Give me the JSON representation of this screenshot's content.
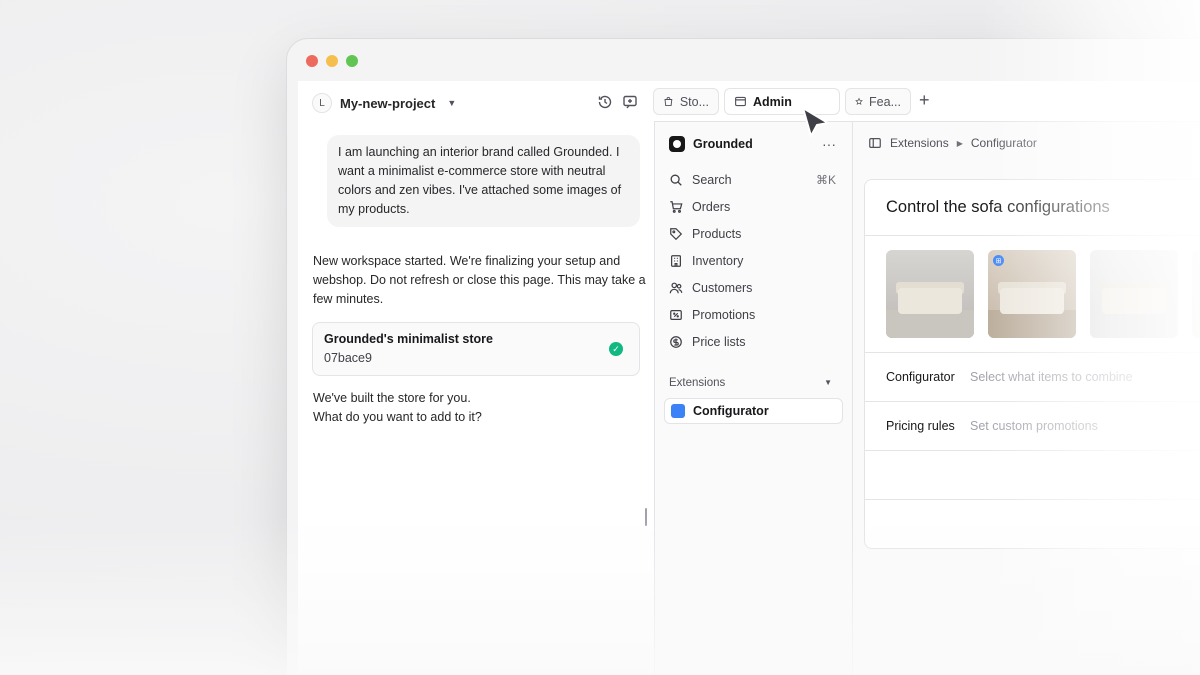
{
  "project": {
    "avatar_initial": "L",
    "name": "My-new-project"
  },
  "chat": {
    "user_message": "I am launching an interior brand called Grounded. I want a minimalist e-commerce store with neutral colors and zen vibes. I've attached some images of my products.",
    "ai_message_1": "New workspace started. We're finalizing your setup and webshop. Do not refresh or close this page. This may take a few minutes.",
    "card": {
      "title": "Grounded's minimalist store",
      "commit": "07bace9"
    },
    "ai_message_2_line1": "We've built the store for you.",
    "ai_message_2_line2": "What do you want to add to it?"
  },
  "tabs": [
    {
      "label": "Sto...",
      "icon": "bag-icon"
    },
    {
      "label": "Admin",
      "icon": "window-icon"
    },
    {
      "label": "Fea...",
      "icon": "star-icon"
    }
  ],
  "sidebar": {
    "store_name": "Grounded",
    "items": [
      {
        "label": "Search",
        "icon": "search-icon",
        "shortcut": "⌘K"
      },
      {
        "label": "Orders",
        "icon": "cart-icon"
      },
      {
        "label": "Products",
        "icon": "tag-icon"
      },
      {
        "label": "Inventory",
        "icon": "building-icon"
      },
      {
        "label": "Customers",
        "icon": "users-icon"
      },
      {
        "label": "Promotions",
        "icon": "receipt-percent-icon"
      },
      {
        "label": "Price lists",
        "icon": "currency-icon"
      }
    ],
    "section_label": "Extensions",
    "active_item": "Configurator"
  },
  "breadcrumb": {
    "parent": "Extensions",
    "current": "Configurator"
  },
  "panel": {
    "title": "Control the sofa configurations",
    "rows": [
      {
        "label": "Configurator",
        "desc": "Select what items to combine"
      },
      {
        "label": "Pricing rules",
        "desc": "Set custom promotions"
      }
    ]
  }
}
